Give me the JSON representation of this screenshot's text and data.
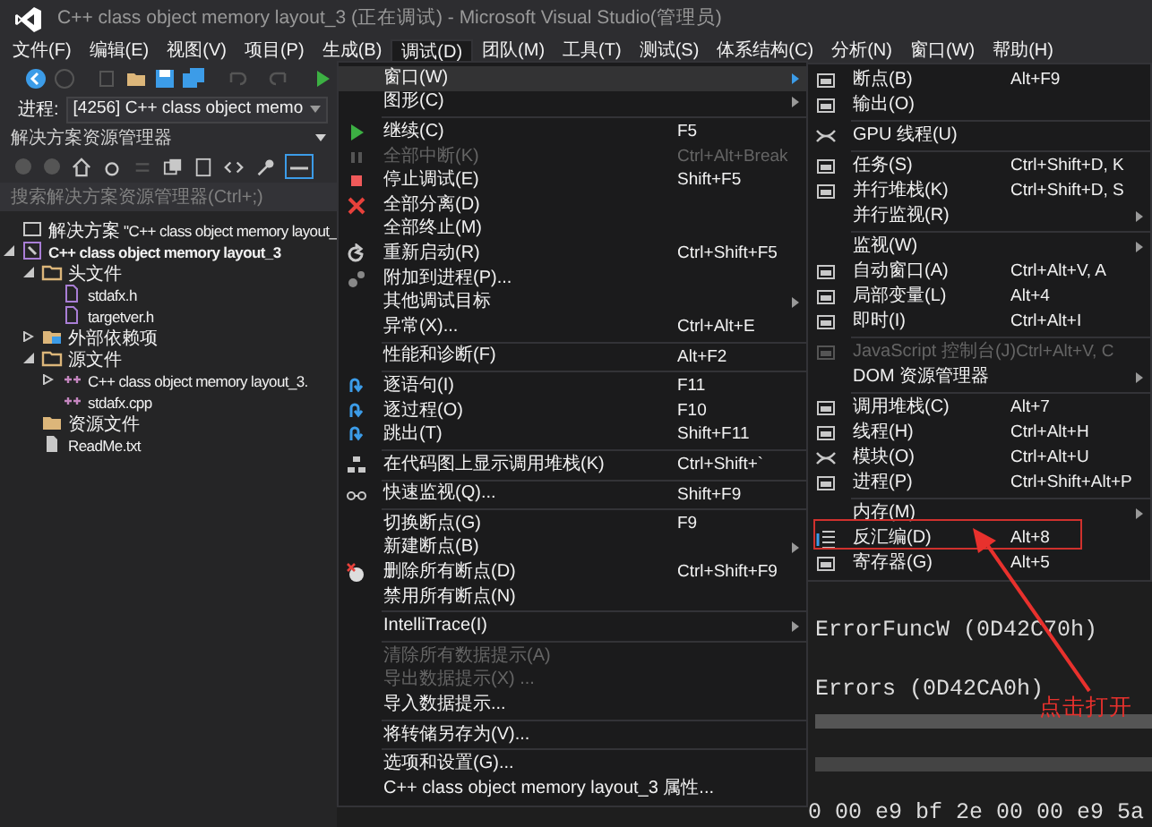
{
  "title_bar": {
    "title": "C++ class object memory layout_3 (正在调试) - Microsoft Visual Studio(管理员)"
  },
  "menu_bar": [
    {
      "label": "文件(F)",
      "selected": false
    },
    {
      "label": "编辑(E)",
      "selected": false
    },
    {
      "label": "视图(V)",
      "selected": false
    },
    {
      "label": "项目(P)",
      "selected": false
    },
    {
      "label": "生成(B)",
      "selected": false
    },
    {
      "label": "调试(D)",
      "selected": true
    },
    {
      "label": "团队(M)",
      "selected": false
    },
    {
      "label": "工具(T)",
      "selected": false
    },
    {
      "label": "测试(S)",
      "selected": false
    },
    {
      "label": "体系结构(C)",
      "selected": false
    },
    {
      "label": "分析(N)",
      "selected": false
    },
    {
      "label": "窗口(W)",
      "selected": false
    },
    {
      "label": "帮助(H)",
      "selected": false
    }
  ],
  "process_bar": {
    "label": "进程:",
    "value": "[4256] C++ class object memo"
  },
  "solution_explorer": {
    "title": "解决方案资源管理器",
    "search": {
      "placeholder": "搜索解决方案资源管理器(Ctrl+;)"
    },
    "tree": [
      {
        "kind": "solution",
        "label": "解决方案 \"C++ class object memory layout_",
        "selected": false,
        "children": [
          {
            "kind": "project",
            "label": "C++ class object memory layout_3",
            "selected": true,
            "expanded": true,
            "children": [
              {
                "kind": "filter",
                "label": "头文件",
                "selected": false,
                "expanded": true,
                "children": [
                  {
                    "kind": "header",
                    "label": "stdafx.h",
                    "selected": false
                  },
                  {
                    "kind": "header",
                    "label": "targetver.h",
                    "selected": false
                  }
                ]
              },
              {
                "kind": "deps",
                "label": "外部依赖项",
                "selected": false,
                "expanded": false
              },
              {
                "kind": "filter",
                "label": "源文件",
                "selected": false,
                "expanded": true,
                "children": [
                  {
                    "kind": "cpp",
                    "label": "C++ class object memory layout_3.",
                    "selected": false,
                    "expanded": false
                  },
                  {
                    "kind": "cpp",
                    "label": "stdafx.cpp",
                    "selected": false
                  }
                ]
              },
              {
                "kind": "folder",
                "label": "资源文件",
                "selected": false
              },
              {
                "kind": "text",
                "label": "ReadMe.txt",
                "selected": false
              }
            ]
          }
        ]
      }
    ]
  },
  "debug_menu": [
    {
      "kind": "item",
      "label": "窗口(W)",
      "submenu": true,
      "disabled": false,
      "selected": true
    },
    {
      "kind": "item",
      "label": "图形(C)",
      "submenu": true,
      "disabled": false,
      "selected": false
    },
    {
      "kind": "separator"
    },
    {
      "kind": "item",
      "label": "继续(C)",
      "shortcut": "F5",
      "submenu": false,
      "disabled": false,
      "selected": false
    },
    {
      "kind": "item",
      "label": "全部中断(K)",
      "shortcut": "Ctrl+Alt+Break",
      "submenu": false,
      "disabled": true,
      "selected": false
    },
    {
      "kind": "item",
      "label": "停止调试(E)",
      "shortcut": "Shift+F5",
      "submenu": false,
      "disabled": false,
      "selected": false
    },
    {
      "kind": "item",
      "label": "全部分离(D)",
      "submenu": false,
      "disabled": false,
      "selected": false
    },
    {
      "kind": "item",
      "label": "全部终止(M)",
      "submenu": false,
      "disabled": false,
      "selected": false
    },
    {
      "kind": "item",
      "label": "重新启动(R)",
      "shortcut": "Ctrl+Shift+F5",
      "submenu": false,
      "disabled": false,
      "selected": false
    },
    {
      "kind": "item",
      "label": "附加到进程(P)...",
      "submenu": false,
      "disabled": false,
      "selected": false
    },
    {
      "kind": "item",
      "label": "其他调试目标",
      "submenu": true,
      "disabled": false,
      "selected": false
    },
    {
      "kind": "item",
      "label": "异常(X)...",
      "shortcut": "Ctrl+Alt+E",
      "submenu": false,
      "disabled": false,
      "selected": false
    },
    {
      "kind": "separator"
    },
    {
      "kind": "item",
      "label": "性能和诊断(F)",
      "shortcut": "Alt+F2",
      "submenu": false,
      "disabled": false,
      "selected": false
    },
    {
      "kind": "separator"
    },
    {
      "kind": "item",
      "label": "逐语句(I)",
      "shortcut": "F11",
      "submenu": false,
      "disabled": false,
      "selected": false
    },
    {
      "kind": "item",
      "label": "逐过程(O)",
      "shortcut": "F10",
      "submenu": false,
      "disabled": false,
      "selected": false
    },
    {
      "kind": "item",
      "label": "跳出(T)",
      "shortcut": "Shift+F11",
      "submenu": false,
      "disabled": false,
      "selected": false
    },
    {
      "kind": "separator"
    },
    {
      "kind": "item",
      "label": "在代码图上显示调用堆栈(K)",
      "shortcut": "Ctrl+Shift+`",
      "submenu": false,
      "disabled": false,
      "selected": false
    },
    {
      "kind": "separator"
    },
    {
      "kind": "item",
      "label": "快速监视(Q)...",
      "shortcut": "Shift+F9",
      "submenu": false,
      "disabled": false,
      "selected": false
    },
    {
      "kind": "separator"
    },
    {
      "kind": "item",
      "label": "切换断点(G)",
      "shortcut": "F9",
      "submenu": false,
      "disabled": false,
      "selected": false
    },
    {
      "kind": "item",
      "label": "新建断点(B)",
      "submenu": true,
      "disabled": false,
      "selected": false
    },
    {
      "kind": "item",
      "label": "删除所有断点(D)",
      "shortcut": "Ctrl+Shift+F9",
      "submenu": false,
      "disabled": false,
      "selected": false
    },
    {
      "kind": "item",
      "label": "禁用所有断点(N)",
      "submenu": false,
      "disabled": false,
      "selected": false
    },
    {
      "kind": "separator"
    },
    {
      "kind": "item",
      "label": "IntelliTrace(I)",
      "submenu": true,
      "disabled": false,
      "selected": false
    },
    {
      "kind": "separator"
    },
    {
      "kind": "item",
      "label": "清除所有数据提示(A)",
      "submenu": false,
      "disabled": true,
      "selected": false
    },
    {
      "kind": "item",
      "label": "导出数据提示(X) ...",
      "submenu": false,
      "disabled": true,
      "selected": false
    },
    {
      "kind": "item",
      "label": "导入数据提示...",
      "submenu": false,
      "disabled": false,
      "selected": false
    },
    {
      "kind": "separator"
    },
    {
      "kind": "item",
      "label": "将转储另存为(V)...",
      "submenu": false,
      "disabled": false,
      "selected": false
    },
    {
      "kind": "separator"
    },
    {
      "kind": "item",
      "label": "选项和设置(G)...",
      "submenu": false,
      "disabled": false,
      "selected": false
    },
    {
      "kind": "item",
      "label": "C++ class object memory layout_3 属性...",
      "submenu": false,
      "disabled": false,
      "selected": false
    }
  ],
  "window_submenu": [
    {
      "kind": "item",
      "label": "断点(B)",
      "shortcut": "Alt+F9",
      "submenu": false,
      "disabled": false,
      "selected": false
    },
    {
      "kind": "item",
      "label": "输出(O)",
      "submenu": false,
      "disabled": false,
      "selected": false
    },
    {
      "kind": "separator"
    },
    {
      "kind": "item",
      "label": "GPU 线程(U)",
      "submenu": false,
      "disabled": false,
      "selected": false
    },
    {
      "kind": "separator"
    },
    {
      "kind": "item",
      "label": "任务(S)",
      "shortcut": "Ctrl+Shift+D, K",
      "submenu": false,
      "disabled": false,
      "selected": false
    },
    {
      "kind": "item",
      "label": "并行堆栈(K)",
      "shortcut": "Ctrl+Shift+D, S",
      "submenu": false,
      "disabled": false,
      "selected": false
    },
    {
      "kind": "item",
      "label": "并行监视(R)",
      "submenu": true,
      "disabled": false,
      "selected": false
    },
    {
      "kind": "separator"
    },
    {
      "kind": "item",
      "label": "监视(W)",
      "submenu": true,
      "disabled": false,
      "selected": false
    },
    {
      "kind": "item",
      "label": "自动窗口(A)",
      "shortcut": "Ctrl+Alt+V, A",
      "submenu": false,
      "disabled": false,
      "selected": false
    },
    {
      "kind": "item",
      "label": "局部变量(L)",
      "shortcut": "Alt+4",
      "submenu": false,
      "disabled": false,
      "selected": false
    },
    {
      "kind": "item",
      "label": "即时(I)",
      "shortcut": "Ctrl+Alt+I",
      "submenu": false,
      "disabled": false,
      "selected": false
    },
    {
      "kind": "separator"
    },
    {
      "kind": "item",
      "label": "JavaScript 控制台(J)",
      "shortcut": "Ctrl+Alt+V, C",
      "submenu": false,
      "disabled": true,
      "selected": false
    },
    {
      "kind": "item",
      "label": "DOM 资源管理器",
      "submenu": true,
      "disabled": false,
      "selected": false
    },
    {
      "kind": "separator"
    },
    {
      "kind": "item",
      "label": "调用堆栈(C)",
      "shortcut": "Alt+7",
      "submenu": false,
      "disabled": false,
      "selected": false
    },
    {
      "kind": "item",
      "label": "线程(H)",
      "shortcut": "Ctrl+Alt+H",
      "submenu": false,
      "disabled": false,
      "selected": false
    },
    {
      "kind": "item",
      "label": "模块(O)",
      "shortcut": "Ctrl+Alt+U",
      "submenu": false,
      "disabled": false,
      "selected": false
    },
    {
      "kind": "item",
      "label": "进程(P)",
      "shortcut": "Ctrl+Shift+Alt+P",
      "submenu": false,
      "disabled": false,
      "selected": false
    },
    {
      "kind": "separator"
    },
    {
      "kind": "item",
      "label": "内存(M)",
      "submenu": true,
      "disabled": false,
      "selected": false
    },
    {
      "kind": "item",
      "label": "反汇编(D)",
      "shortcut": "Alt+8",
      "submenu": false,
      "disabled": false,
      "selected": false
    },
    {
      "kind": "item",
      "label": "寄存器(G)",
      "shortcut": "Alt+5",
      "submenu": false,
      "disabled": false,
      "selected": false
    }
  ],
  "editor": {
    "lines": [
      "ErrorFuncW (0D42C70h)",
      "Errors (0D42CA0h)",
      "0 00 e9 bf 2e 00 00 e9 5a"
    ]
  },
  "annotation": {
    "text": "点击打开"
  }
}
